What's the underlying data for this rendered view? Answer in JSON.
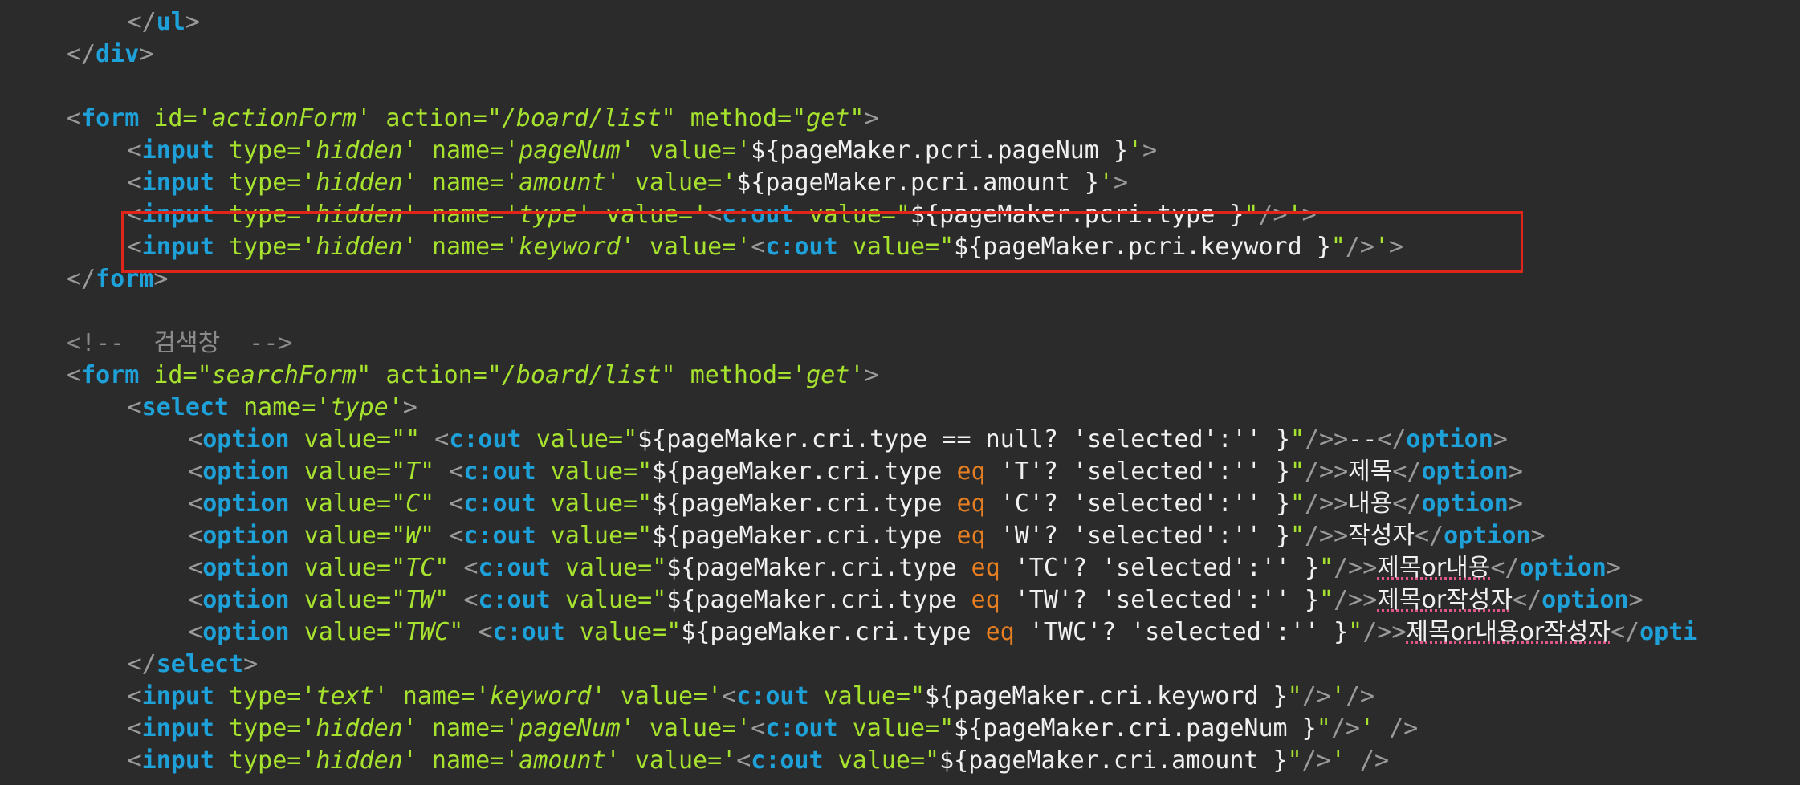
{
  "lines": [
    {
      "indent": 8,
      "tokens": [
        [
          "pun",
          "</"
        ],
        [
          "tag",
          "ul"
        ],
        [
          "pun",
          ">"
        ]
      ]
    },
    {
      "indent": 4,
      "tokens": [
        [
          "pun",
          "</"
        ],
        [
          "tag",
          "div"
        ],
        [
          "pun",
          ">"
        ]
      ]
    },
    {
      "indent": 0,
      "tokens": []
    },
    {
      "indent": 4,
      "tokens": [
        [
          "pun",
          "<"
        ],
        [
          "tag",
          "form"
        ],
        [
          "pl",
          " "
        ],
        [
          "att",
          "id="
        ],
        [
          "str",
          "'actionForm'"
        ],
        [
          "pl",
          " "
        ],
        [
          "att",
          "action="
        ],
        [
          "str",
          "\"/board/list\""
        ],
        [
          "pl",
          " "
        ],
        [
          "att",
          "method="
        ],
        [
          "str",
          "\"get\""
        ],
        [
          "pun",
          ">"
        ]
      ]
    },
    {
      "indent": 8,
      "tokens": [
        [
          "pun",
          "<"
        ],
        [
          "tag",
          "input"
        ],
        [
          "pl",
          " "
        ],
        [
          "att",
          "type="
        ],
        [
          "str",
          "'hidden'"
        ],
        [
          "pl",
          " "
        ],
        [
          "att",
          "name="
        ],
        [
          "str",
          "'pageNum'"
        ],
        [
          "pl",
          " "
        ],
        [
          "att",
          "value="
        ],
        [
          "str",
          "'"
        ],
        [
          "pl",
          "${pageMaker.pcri.pageNum }"
        ],
        [
          "str",
          "'"
        ],
        [
          "pun",
          ">"
        ]
      ]
    },
    {
      "indent": 8,
      "tokens": [
        [
          "pun",
          "<"
        ],
        [
          "tag",
          "input"
        ],
        [
          "pl",
          " "
        ],
        [
          "att",
          "type="
        ],
        [
          "str",
          "'hidden'"
        ],
        [
          "pl",
          " "
        ],
        [
          "att",
          "name="
        ],
        [
          "str",
          "'amount'"
        ],
        [
          "pl",
          " "
        ],
        [
          "att",
          "value="
        ],
        [
          "str",
          "'"
        ],
        [
          "pl",
          "${pageMaker.pcri.amount }"
        ],
        [
          "str",
          "'"
        ],
        [
          "pun",
          ">"
        ]
      ]
    },
    {
      "indent": 8,
      "tokens": [
        [
          "pun",
          "<"
        ],
        [
          "tag",
          "input"
        ],
        [
          "pl",
          " "
        ],
        [
          "att",
          "type="
        ],
        [
          "str",
          "'hidden'"
        ],
        [
          "pl",
          " "
        ],
        [
          "att",
          "name="
        ],
        [
          "str",
          "'type'"
        ],
        [
          "pl",
          " "
        ],
        [
          "att",
          "value="
        ],
        [
          "str",
          "'"
        ],
        [
          "pun",
          "<"
        ],
        [
          "tag",
          "c:out"
        ],
        [
          "pl",
          " "
        ],
        [
          "att",
          "value="
        ],
        [
          "str",
          "\""
        ],
        [
          "pl",
          "${pageMaker.pcri.type }"
        ],
        [
          "str",
          "\""
        ],
        [
          "pun",
          "/>"
        ],
        [
          "str",
          "'"
        ],
        [
          "pun",
          ">"
        ]
      ]
    },
    {
      "indent": 8,
      "tokens": [
        [
          "pun",
          "<"
        ],
        [
          "tag",
          "input"
        ],
        [
          "pl",
          " "
        ],
        [
          "att",
          "type="
        ],
        [
          "str",
          "'hidden'"
        ],
        [
          "pl",
          " "
        ],
        [
          "att",
          "name="
        ],
        [
          "str",
          "'keyword'"
        ],
        [
          "pl",
          " "
        ],
        [
          "att",
          "value="
        ],
        [
          "str",
          "'"
        ],
        [
          "pun",
          "<"
        ],
        [
          "tag",
          "c:out"
        ],
        [
          "pl",
          " "
        ],
        [
          "att",
          "value="
        ],
        [
          "str",
          "\""
        ],
        [
          "pl",
          "${pageMaker.pcri.keyword }"
        ],
        [
          "str",
          "\""
        ],
        [
          "pun",
          "/>"
        ],
        [
          "str",
          "'"
        ],
        [
          "pun",
          ">"
        ]
      ]
    },
    {
      "indent": 4,
      "tokens": [
        [
          "pun",
          "</"
        ],
        [
          "tag",
          "form"
        ],
        [
          "pun",
          ">"
        ]
      ]
    },
    {
      "indent": 0,
      "tokens": []
    },
    {
      "indent": 4,
      "tokens": [
        [
          "com",
          "<!--  "
        ],
        [
          "ko_com",
          "검색창"
        ],
        [
          "com",
          "  -->"
        ]
      ]
    },
    {
      "indent": 4,
      "tokens": [
        [
          "pun",
          "<"
        ],
        [
          "tag",
          "form"
        ],
        [
          "pl",
          " "
        ],
        [
          "att",
          "id="
        ],
        [
          "str",
          "\"searchForm\""
        ],
        [
          "pl",
          " "
        ],
        [
          "att",
          "action="
        ],
        [
          "str",
          "\"/board/list\""
        ],
        [
          "pl",
          " "
        ],
        [
          "att",
          "method="
        ],
        [
          "str",
          "'get'"
        ],
        [
          "pun",
          ">"
        ]
      ]
    },
    {
      "indent": 8,
      "tokens": [
        [
          "pun",
          "<"
        ],
        [
          "tag",
          "select"
        ],
        [
          "pl",
          " "
        ],
        [
          "att",
          "name="
        ],
        [
          "str",
          "'type'"
        ],
        [
          "pun",
          ">"
        ]
      ]
    },
    {
      "indent": 12,
      "tokens": [
        [
          "pun",
          "<"
        ],
        [
          "tag",
          "option"
        ],
        [
          "pl",
          " "
        ],
        [
          "att",
          "value="
        ],
        [
          "str",
          "\"\""
        ],
        [
          "pl",
          " "
        ],
        [
          "pun",
          "<"
        ],
        [
          "tag",
          "c:out"
        ],
        [
          "pl",
          " "
        ],
        [
          "att",
          "value="
        ],
        [
          "str",
          "\""
        ],
        [
          "pl",
          "${pageMaker.cri.type == null? 'selected':'' }"
        ],
        [
          "str",
          "\""
        ],
        [
          "pun",
          "/>>"
        ],
        [
          "pl",
          "--"
        ],
        [
          "pun",
          "</"
        ],
        [
          "tag",
          "option"
        ],
        [
          "pun",
          ">"
        ]
      ]
    },
    {
      "indent": 12,
      "tokens": [
        [
          "pun",
          "<"
        ],
        [
          "tag",
          "option"
        ],
        [
          "pl",
          " "
        ],
        [
          "att",
          "value="
        ],
        [
          "str",
          "\"T\""
        ],
        [
          "pl",
          " "
        ],
        [
          "pun",
          "<"
        ],
        [
          "tag",
          "c:out"
        ],
        [
          "pl",
          " "
        ],
        [
          "att",
          "value="
        ],
        [
          "str",
          "\""
        ],
        [
          "pl",
          "${pageMaker.cri.type "
        ],
        [
          "kw",
          "eq"
        ],
        [
          "pl",
          " 'T'? 'selected':'' }"
        ],
        [
          "str",
          "\""
        ],
        [
          "pun",
          "/>>"
        ],
        [
          "ko",
          "제목"
        ],
        [
          "pun",
          "</"
        ],
        [
          "tag",
          "option"
        ],
        [
          "pun",
          ">"
        ]
      ]
    },
    {
      "indent": 12,
      "tokens": [
        [
          "pun",
          "<"
        ],
        [
          "tag",
          "option"
        ],
        [
          "pl",
          " "
        ],
        [
          "att",
          "value="
        ],
        [
          "str",
          "\"C\""
        ],
        [
          "pl",
          " "
        ],
        [
          "pun",
          "<"
        ],
        [
          "tag",
          "c:out"
        ],
        [
          "pl",
          " "
        ],
        [
          "att",
          "value="
        ],
        [
          "str",
          "\""
        ],
        [
          "pl",
          "${pageMaker.cri.type "
        ],
        [
          "kw",
          "eq"
        ],
        [
          "pl",
          " 'C'? 'selected':'' }"
        ],
        [
          "str",
          "\""
        ],
        [
          "pun",
          "/>>"
        ],
        [
          "ko",
          "내용"
        ],
        [
          "pun",
          "</"
        ],
        [
          "tag",
          "option"
        ],
        [
          "pun",
          ">"
        ]
      ]
    },
    {
      "indent": 12,
      "tokens": [
        [
          "pun",
          "<"
        ],
        [
          "tag",
          "option"
        ],
        [
          "pl",
          " "
        ],
        [
          "att",
          "value="
        ],
        [
          "str",
          "\"W\""
        ],
        [
          "pl",
          " "
        ],
        [
          "pun",
          "<"
        ],
        [
          "tag",
          "c:out"
        ],
        [
          "pl",
          " "
        ],
        [
          "att",
          "value="
        ],
        [
          "str",
          "\""
        ],
        [
          "pl",
          "${pageMaker.cri.type "
        ],
        [
          "kw",
          "eq"
        ],
        [
          "pl",
          " 'W'? 'selected':'' }"
        ],
        [
          "str",
          "\""
        ],
        [
          "pun",
          "/>>"
        ],
        [
          "ko",
          "작성자"
        ],
        [
          "pun",
          "</"
        ],
        [
          "tag",
          "option"
        ],
        [
          "pun",
          ">"
        ]
      ]
    },
    {
      "indent": 12,
      "tokens": [
        [
          "pun",
          "<"
        ],
        [
          "tag",
          "option"
        ],
        [
          "pl",
          " "
        ],
        [
          "att",
          "value="
        ],
        [
          "str",
          "\"TC\""
        ],
        [
          "pl",
          " "
        ],
        [
          "pun",
          "<"
        ],
        [
          "tag",
          "c:out"
        ],
        [
          "pl",
          " "
        ],
        [
          "att",
          "value="
        ],
        [
          "str",
          "\""
        ],
        [
          "pl",
          "${pageMaker.cri.type "
        ],
        [
          "kw",
          "eq"
        ],
        [
          "pl",
          " 'TC'? 'selected':'' }"
        ],
        [
          "str",
          "\""
        ],
        [
          "pun",
          "/>>"
        ],
        [
          "kosq",
          "제목or내용"
        ],
        [
          "pun",
          "</"
        ],
        [
          "tag",
          "option"
        ],
        [
          "pun",
          ">"
        ]
      ]
    },
    {
      "indent": 12,
      "tokens": [
        [
          "pun",
          "<"
        ],
        [
          "tag",
          "option"
        ],
        [
          "pl",
          " "
        ],
        [
          "att",
          "value="
        ],
        [
          "str",
          "\"TW\""
        ],
        [
          "pl",
          " "
        ],
        [
          "pun",
          "<"
        ],
        [
          "tag",
          "c:out"
        ],
        [
          "pl",
          " "
        ],
        [
          "att",
          "value="
        ],
        [
          "str",
          "\""
        ],
        [
          "pl",
          "${pageMaker.cri.type "
        ],
        [
          "kw",
          "eq"
        ],
        [
          "pl",
          " 'TW'? 'selected':'' }"
        ],
        [
          "str",
          "\""
        ],
        [
          "pun",
          "/>>"
        ],
        [
          "kosq",
          "제목or작성자"
        ],
        [
          "pun",
          "</"
        ],
        [
          "tag",
          "option"
        ],
        [
          "pun",
          ">"
        ]
      ]
    },
    {
      "indent": 12,
      "tokens": [
        [
          "pun",
          "<"
        ],
        [
          "tag",
          "option"
        ],
        [
          "pl",
          " "
        ],
        [
          "att",
          "value="
        ],
        [
          "str",
          "\"TWC\""
        ],
        [
          "pl",
          " "
        ],
        [
          "pun",
          "<"
        ],
        [
          "tag",
          "c:out"
        ],
        [
          "pl",
          " "
        ],
        [
          "att",
          "value="
        ],
        [
          "str",
          "\""
        ],
        [
          "pl",
          "${pageMaker.cri.type "
        ],
        [
          "kw",
          "eq"
        ],
        [
          "pl",
          " 'TWC'? 'selected':'' }"
        ],
        [
          "str",
          "\""
        ],
        [
          "pun",
          "/>>"
        ],
        [
          "kosq",
          "제목or내용or작성자"
        ],
        [
          "pun",
          "</"
        ],
        [
          "tag",
          "opti"
        ]
      ]
    },
    {
      "indent": 8,
      "tokens": [
        [
          "pun",
          "</"
        ],
        [
          "tag",
          "select"
        ],
        [
          "pun",
          ">"
        ]
      ]
    },
    {
      "indent": 8,
      "tokens": [
        [
          "pun",
          "<"
        ],
        [
          "tag",
          "input"
        ],
        [
          "pl",
          " "
        ],
        [
          "att",
          "type="
        ],
        [
          "str",
          "'text'"
        ],
        [
          "pl",
          " "
        ],
        [
          "att",
          "name="
        ],
        [
          "str",
          "'keyword'"
        ],
        [
          "pl",
          " "
        ],
        [
          "att",
          "value="
        ],
        [
          "str",
          "'"
        ],
        [
          "pun",
          "<"
        ],
        [
          "tag",
          "c:out"
        ],
        [
          "pl",
          " "
        ],
        [
          "att",
          "value="
        ],
        [
          "str",
          "\""
        ],
        [
          "pl",
          "${pageMaker.cri.keyword }"
        ],
        [
          "str",
          "\""
        ],
        [
          "pun",
          "/>"
        ],
        [
          "str",
          "'"
        ],
        [
          "pun",
          "/>"
        ]
      ]
    },
    {
      "indent": 8,
      "tokens": [
        [
          "pun",
          "<"
        ],
        [
          "tag",
          "input"
        ],
        [
          "pl",
          " "
        ],
        [
          "att",
          "type="
        ],
        [
          "str",
          "'hidden'"
        ],
        [
          "pl",
          " "
        ],
        [
          "att",
          "name="
        ],
        [
          "str",
          "'pageNum'"
        ],
        [
          "pl",
          " "
        ],
        [
          "att",
          "value="
        ],
        [
          "str",
          "'"
        ],
        [
          "pun",
          "<"
        ],
        [
          "tag",
          "c:out"
        ],
        [
          "pl",
          " "
        ],
        [
          "att",
          "value="
        ],
        [
          "str",
          "\""
        ],
        [
          "pl",
          "${pageMaker.cri.pageNum }"
        ],
        [
          "str",
          "\""
        ],
        [
          "pun",
          "/>"
        ],
        [
          "str",
          "'"
        ],
        [
          "pl",
          " "
        ],
        [
          "pun",
          "/>"
        ]
      ]
    },
    {
      "indent": 8,
      "tokens": [
        [
          "pun",
          "<"
        ],
        [
          "tag",
          "input"
        ],
        [
          "pl",
          " "
        ],
        [
          "att",
          "type="
        ],
        [
          "str",
          "'hidden'"
        ],
        [
          "pl",
          " "
        ],
        [
          "att",
          "name="
        ],
        [
          "str",
          "'amount'"
        ],
        [
          "pl",
          " "
        ],
        [
          "att",
          "value="
        ],
        [
          "str",
          "'"
        ],
        [
          "pun",
          "<"
        ],
        [
          "tag",
          "c:out"
        ],
        [
          "pl",
          " "
        ],
        [
          "att",
          "value="
        ],
        [
          "str",
          "\""
        ],
        [
          "pl",
          "${pageMaker.cri.amount }"
        ],
        [
          "str",
          "\""
        ],
        [
          "pun",
          "/>"
        ],
        [
          "str",
          "'"
        ],
        [
          "pl",
          " "
        ],
        [
          "pun",
          "/>"
        ]
      ]
    }
  ],
  "highlight": {
    "from_line": 7,
    "to_line": 8,
    "color": "#e0261b"
  },
  "colors": {
    "background": "#2b2b2b",
    "tag": "#1ea0d8",
    "attribute": "#a6e22e",
    "string": "#a6e22e",
    "punctuation": "#9a9a9a",
    "keyword": "#e67e22",
    "text": "#f0f0f0",
    "comment": "#8a8a8a"
  }
}
